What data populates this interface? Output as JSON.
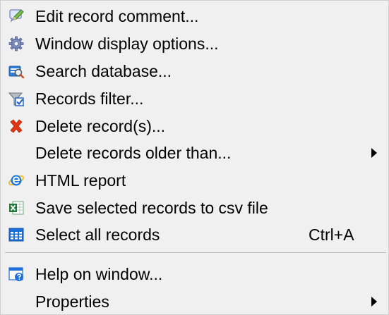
{
  "menu": {
    "items": [
      {
        "label": "Edit record comment...",
        "icon": "edit-comment-icon"
      },
      {
        "label": "Window display options...",
        "icon": "gear-icon"
      },
      {
        "label": "Search database...",
        "icon": "search-icon"
      },
      {
        "label": "Records filter...",
        "icon": "filter-icon"
      },
      {
        "label": "Delete record(s)...",
        "icon": "delete-icon",
        "icon_color": "#e03616"
      },
      {
        "label": "Delete records older than...",
        "icon": "",
        "has_submenu": true
      },
      {
        "label": "HTML report",
        "icon": "internet-explorer-icon",
        "icon_color": "#1e78d2"
      },
      {
        "label": "Save selected records to csv file",
        "icon": "excel-icon",
        "icon_color": "#1f7a3a"
      },
      {
        "label": "Select all records",
        "icon": "table-grid-icon",
        "icon_color": "#1e6fd9",
        "shortcut": "Ctrl+A"
      },
      {
        "label": "Help on window...",
        "icon": "help-window-icon",
        "icon_color": "#1e6fd9"
      },
      {
        "label": "Properties",
        "icon": "",
        "has_submenu": true
      }
    ]
  }
}
